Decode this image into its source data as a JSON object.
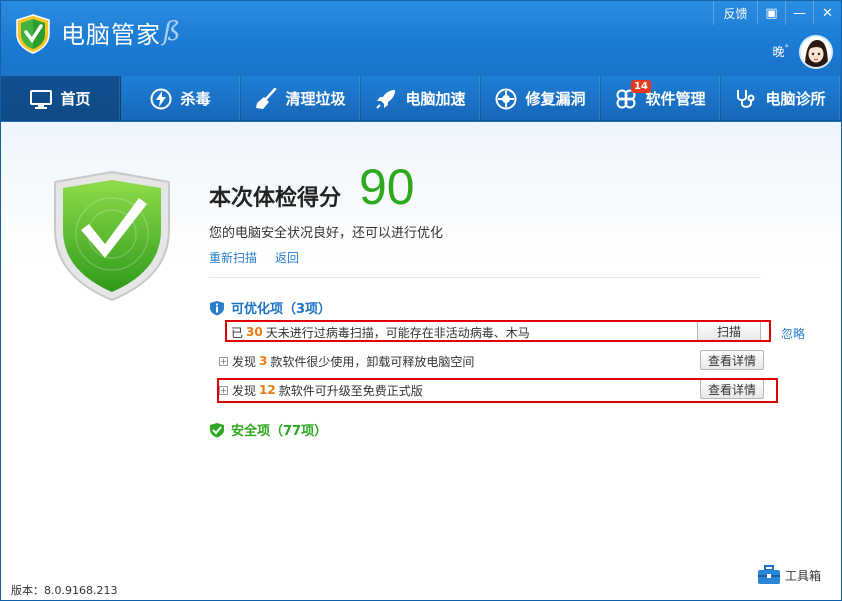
{
  "titlebar": {
    "app_title": "电脑管家",
    "swash": "ß",
    "feedback": "反馈",
    "skin_icon": "▣",
    "minimize": "—",
    "maximize": "□",
    "close": "✕",
    "greeting": "晚",
    "greeting_mark": "°"
  },
  "nav": {
    "items": [
      {
        "label": "首页",
        "icon": "monitor-icon"
      },
      {
        "label": "杀毒",
        "icon": "lightning-icon"
      },
      {
        "label": "清理垃圾",
        "icon": "broom-icon"
      },
      {
        "label": "电脑加速",
        "icon": "rocket-icon"
      },
      {
        "label": "修复漏洞",
        "icon": "patch-icon"
      },
      {
        "label": "软件管理",
        "icon": "software-icon",
        "badge": "14"
      },
      {
        "label": "电脑诊所",
        "icon": "stethoscope-icon"
      }
    ]
  },
  "scan": {
    "title": "本次体检得分",
    "score": "90",
    "description": "您的电脑安全状况良好，还可以进行优化",
    "rescan": "重新扫描",
    "back": "返回"
  },
  "optimizable": {
    "heading": "可优化项（3项）",
    "items": [
      {
        "prefix": "已",
        "num": "30",
        "suffix": "天未进行过病毒扫描，可能存在非活动病毒、木马",
        "button": "扫描",
        "extra": "忽略"
      },
      {
        "prefix": "发现",
        "num": "3",
        "suffix": "款软件很少使用，卸载可释放电脑空间",
        "button": "查看详情"
      },
      {
        "prefix": "发现",
        "num": "12",
        "suffix": "款软件可升级至免费正式版",
        "button": "查看详情"
      }
    ]
  },
  "safe": {
    "heading": "安全项（77项）"
  },
  "footer": {
    "version": "版本：8.0.9168.213",
    "toolbox": "工具箱"
  },
  "colors": {
    "accent": "#1b7ad2",
    "score_green": "#2ea81e",
    "highlight_orange": "#f07a10",
    "annotation_red": "#e00000"
  }
}
